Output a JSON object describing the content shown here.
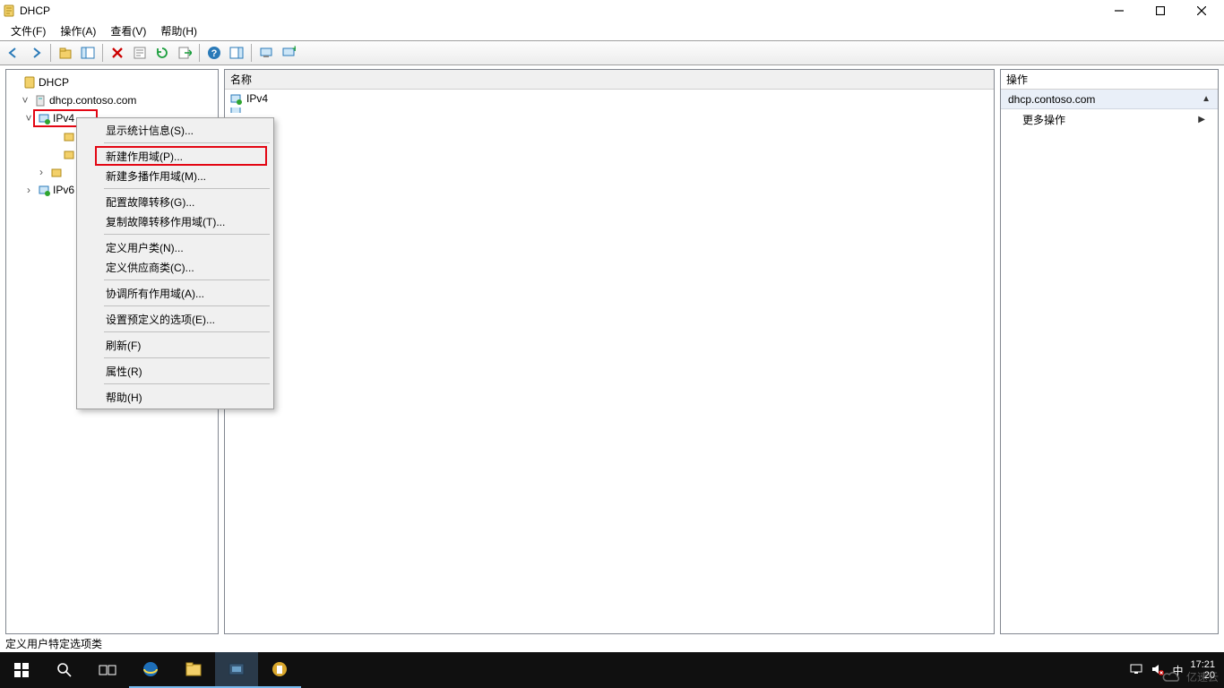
{
  "title": "DHCP",
  "menubar": {
    "file": "文件(F)",
    "action": "操作(A)",
    "view": "查看(V)",
    "help": "帮助(H)"
  },
  "tree": {
    "root": "DHCP",
    "server": "dhcp.contoso.com",
    "ipv4": "IPv4",
    "ipv6": "IPv6"
  },
  "middle": {
    "col_name": "名称",
    "item_ipv4": "IPv4"
  },
  "right": {
    "actions_title": "操作",
    "group": "dhcp.contoso.com",
    "more": "更多操作"
  },
  "context": {
    "stats": "显示统计信息(S)...",
    "new_scope": "新建作用域(P)...",
    "new_multicast": "新建多播作用域(M)...",
    "config_failover": "配置故障转移(G)...",
    "replicate_failover": "复制故障转移作用域(T)...",
    "define_user": "定义用户类(N)...",
    "define_vendor": "定义供应商类(C)...",
    "reconcile": "协调所有作用域(A)...",
    "set_predef": "设置预定义的选项(E)...",
    "refresh": "刷新(F)",
    "properties": "属性(R)",
    "help": "帮助(H)"
  },
  "statusbar": "定义用户特定选项类",
  "taskbar": {
    "ime": "中",
    "time": "17:21",
    "date_prefix": "20"
  },
  "watermark": "亿速云"
}
